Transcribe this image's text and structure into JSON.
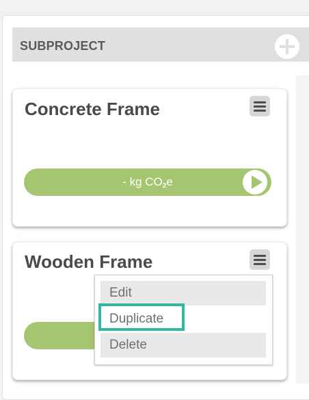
{
  "subproject": {
    "header_title": "SUBPROJECT",
    "add_icon": "plus-circle-icon"
  },
  "cards": [
    {
      "title": "Concrete Frame",
      "co2_prefix": "- kg CO",
      "co2_subscript": "2",
      "co2_suffix": "e",
      "menu_icon": "hamburger-menu-icon",
      "play_icon": "play-icon"
    },
    {
      "title": "Wooden Frame",
      "menu_icon": "hamburger-menu-icon"
    }
  ],
  "context_menu": {
    "items": [
      "Edit",
      "Duplicate",
      "Delete"
    ],
    "highlighted": "Duplicate"
  },
  "colors": {
    "accent_green": "#a5c571",
    "highlight_teal": "#2fb9a3",
    "header_gray": "#e0e0e0"
  }
}
